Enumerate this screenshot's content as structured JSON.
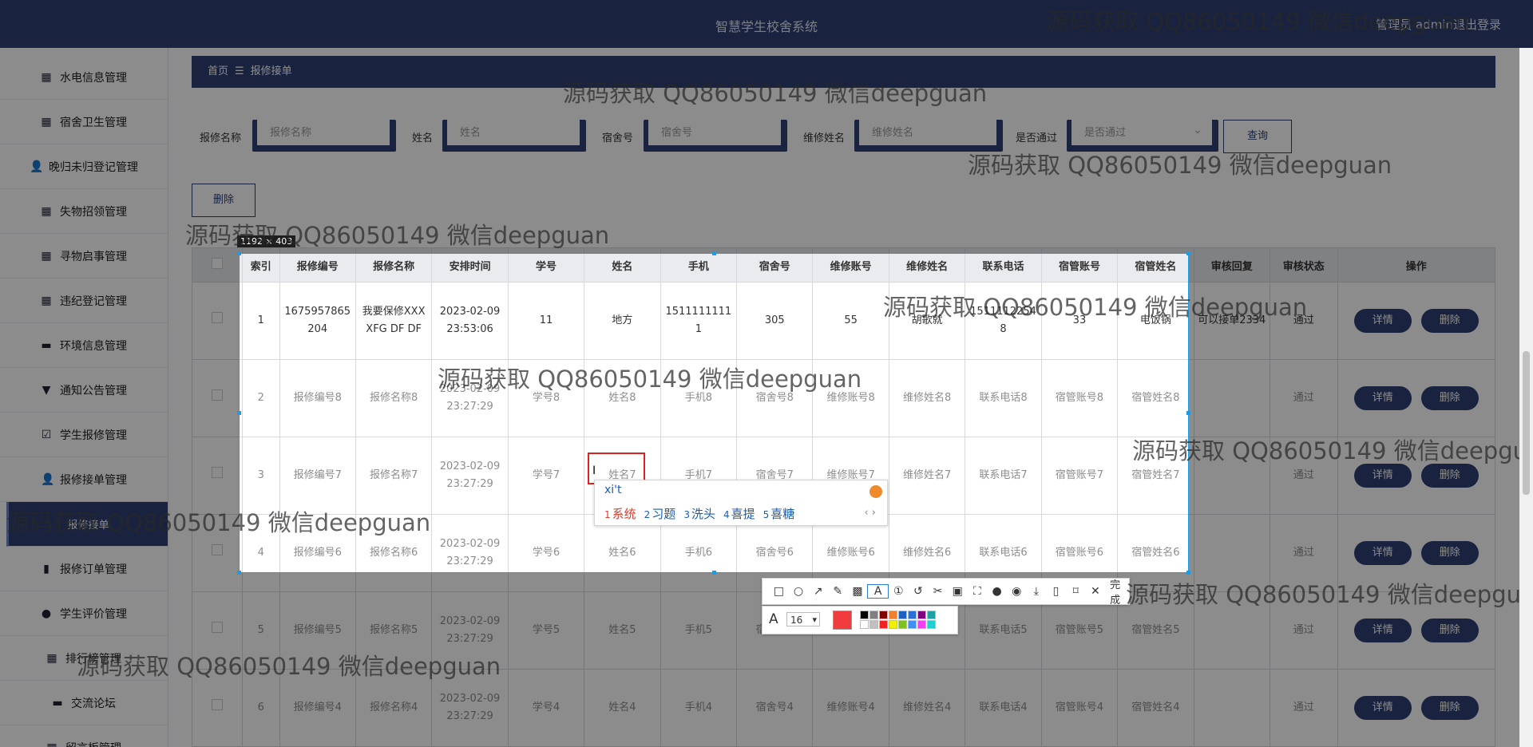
{
  "header": {
    "title": "智慧学生校舍系统",
    "user_text": "管理员 admin",
    "logout_label": "退出登录"
  },
  "sidebar": {
    "items": [
      {
        "label": "水电信息管理",
        "icon": "grid-icon"
      },
      {
        "label": "宿舍卫生管理",
        "icon": "grid-icon"
      },
      {
        "label": "晚归未归登记管理",
        "icon": "person-icon"
      },
      {
        "label": "失物招领管理",
        "icon": "grid-icon"
      },
      {
        "label": "寻物启事管理",
        "icon": "grid-icon"
      },
      {
        "label": "违纪登记管理",
        "icon": "grid-icon"
      },
      {
        "label": "环境信息管理",
        "icon": "monitor-icon"
      },
      {
        "label": "通知公告管理",
        "icon": "notice-icon"
      },
      {
        "label": "学生报修管理",
        "icon": "check-icon"
      },
      {
        "label": "报修接单管理",
        "icon": "person-icon"
      },
      {
        "label": "报修接单",
        "icon": "",
        "sub": true
      },
      {
        "label": "报修订单管理",
        "icon": "bar-chart-icon"
      },
      {
        "label": "学生评价管理",
        "icon": "pin-icon"
      },
      {
        "label": "排行榜管理",
        "icon": "grid-icon"
      },
      {
        "label": "交流论坛",
        "icon": "monitor-icon"
      },
      {
        "label": "留言板管理",
        "icon": "grid-icon"
      }
    ]
  },
  "breadcrumb": {
    "home": "首页",
    "separator": "☰",
    "current": "报修接单"
  },
  "filters": {
    "f1_label": "报修名称",
    "f1_placeholder": "报修名称",
    "f2_label": "姓名",
    "f2_placeholder": "姓名",
    "f3_label": "宿舍号",
    "f3_placeholder": "宿舍号",
    "f4_label": "维修姓名",
    "f4_placeholder": "维修姓名",
    "f5_label": "是否通过",
    "f5_placeholder": "是否通过",
    "query_label": "查询"
  },
  "delete_label": "删除",
  "table": {
    "headers": [
      "索引",
      "报修编号",
      "报修名称",
      "安排时间",
      "学号",
      "姓名",
      "手机",
      "宿舍号",
      "维修账号",
      "维修姓名",
      "联系电话",
      "宿管账号",
      "宿管姓名",
      "审核回复",
      "审核状态",
      "操作"
    ],
    "detail_label": "详情",
    "delete_label": "删除",
    "rows": [
      {
        "c": [
          "1",
          "1675957865204",
          "我要保修XXXXFG DF DF",
          "2023-02-09 23:53:06",
          "11",
          "地方",
          "15111111111",
          "305",
          "55",
          "胡歌就",
          "15111122548",
          "33",
          "电饭锅",
          "可以接单2334",
          "通过"
        ]
      },
      {
        "c": [
          "2",
          "报修编号8",
          "报修名称8",
          "2023-02-09 23:27:29",
          "学号8",
          "姓名8",
          "手机8",
          "宿舍号8",
          "维修账号8",
          "维修姓名8",
          "联系电话8",
          "宿管账号8",
          "宿管姓名8",
          "",
          "通过"
        ]
      },
      {
        "c": [
          "3",
          "报修编号7",
          "报修名称7",
          "2023-02-09 23:27:29",
          "学号7",
          "姓名7",
          "手机7",
          "宿舍号7",
          "维修账号7",
          "维修姓名7",
          "联系电话7",
          "宿管账号7",
          "宿管姓名7",
          "",
          "通过"
        ]
      },
      {
        "c": [
          "4",
          "报修编号6",
          "报修名称6",
          "2023-02-09 23:27:29",
          "学号6",
          "姓名6",
          "手机6",
          "宿舍号6",
          "维修账号6",
          "维修姓名6",
          "联系电话6",
          "宿管账号6",
          "宿管姓名6",
          "",
          "通过"
        ]
      },
      {
        "c": [
          "5",
          "报修编号5",
          "报修名称5",
          "2023-02-09 23:27:29",
          "学号5",
          "姓名5",
          "手机5",
          "宿舍号5",
          "维修账号5",
          "维修姓名5",
          "联系电话5",
          "宿管账号5",
          "宿管姓名5",
          "",
          "通过"
        ]
      },
      {
        "c": [
          "6",
          "报修编号4",
          "报修名称4",
          "2023-02-09 23:27:29",
          "学号4",
          "姓名4",
          "手机4",
          "宿舍号4",
          "维修账号4",
          "维修姓名4",
          "联系电话4",
          "宿管账号4",
          "宿管姓名4",
          "",
          "通过"
        ]
      }
    ]
  },
  "capture": {
    "size_label": "1192 × 403"
  },
  "ime": {
    "typed": "xi't",
    "candidates": [
      {
        "num": "1",
        "text": "系统"
      },
      {
        "num": "2",
        "text": "习题"
      },
      {
        "num": "3",
        "text": "洗头"
      },
      {
        "num": "4",
        "text": "喜提"
      },
      {
        "num": "5",
        "text": "喜糖"
      }
    ],
    "nav": "‹ ›"
  },
  "annot_toolbar": {
    "tools": [
      "rect-icon",
      "ellipse-icon",
      "arrow-icon",
      "pen-icon",
      "mosaic-icon",
      "text-icon",
      "number-icon",
      "undo-icon",
      "eraser-icon",
      "ocr-icon",
      "scroll-capture-icon",
      "pin-icon",
      "record-icon",
      "save-icon",
      "copy-icon",
      "bookmark-icon",
      "close-icon"
    ],
    "done_label": "完成",
    "font_size": "16",
    "colors": [
      "#000000",
      "#808080",
      "#800000",
      "#f08030",
      "#2060c0",
      "#2a6fd4",
      "#800080",
      "#20a0a0",
      "#ffffff",
      "#c0c0c0",
      "#f02020",
      "#f0f000",
      "#80c020",
      "#4090f0",
      "#f040f0",
      "#20d0d0"
    ],
    "current_color": "#f03c3c"
  },
  "watermark": "源码获取 QQ86050149 微信deepguan"
}
